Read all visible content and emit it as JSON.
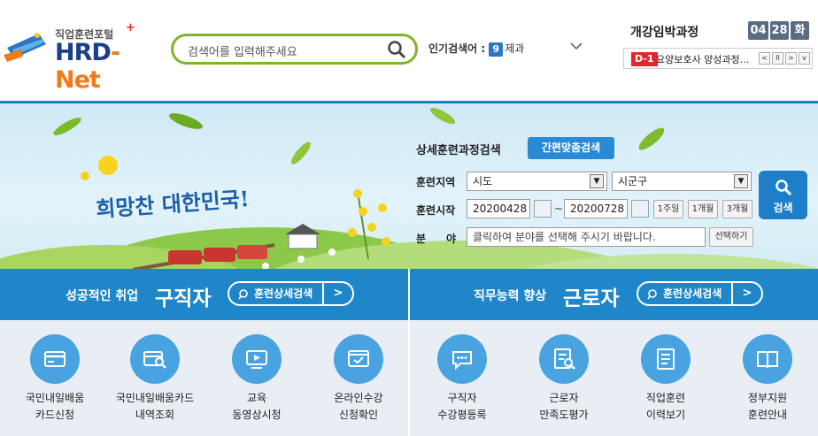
{
  "header": {
    "logo_sub": "직업훈련포털",
    "logo_main_a": "HRD",
    "logo_main_b": "-Net",
    "search_placeholder": "검색어를 입력해주세요",
    "popular_label": "인기검색어 :",
    "popular_rank": "9",
    "popular_term": "제과"
  },
  "upcoming": {
    "title": "개강임박과정",
    "month": "04",
    "day": "28",
    "weekday": "화",
    "dday": "D-1",
    "course": "요양보호사 양성과정…"
  },
  "form": {
    "title": "상세훈련과정검색",
    "quick_button": "간편맞춤검색",
    "region_label": "훈련지역",
    "region_city": "시도",
    "region_district": "시군구",
    "start_label": "훈련시작",
    "date_from": "20200428",
    "tilde": "~",
    "date_to": "20200728",
    "range_1w": "1주일",
    "range_1m": "1개월",
    "range_3m": "3개월",
    "field_label_a": "분",
    "field_label_b": "야",
    "field_placeholder": "클릭하여 분야를 선택해 주시기 바랍니다.",
    "select_button": "선택하기",
    "search_button": "검색"
  },
  "banner": {
    "slogan": "희망찬 대한민국!"
  },
  "jobseeker": {
    "lead": "성공적인 취업",
    "title": "구직자",
    "button": "훈련상세검색"
  },
  "worker": {
    "lead": "직무능력 향상",
    "title": "근로자",
    "button": "훈련상세검색"
  },
  "menu": [
    {
      "l1": "국민내일배움",
      "l2": "카드신청",
      "icon": "card-icon"
    },
    {
      "l1": "국민내일배움카드",
      "l2": "내역조회",
      "icon": "card-search-icon"
    },
    {
      "l1": "교육",
      "l2": "동영상시청",
      "icon": "video-icon"
    },
    {
      "l1": "온라인수강",
      "l2": "신청확인",
      "icon": "online-check-icon"
    },
    {
      "l1": "구직자",
      "l2": "수강평등록",
      "icon": "review-icon"
    },
    {
      "l1": "근로자",
      "l2": "만족도평가",
      "icon": "survey-icon"
    },
    {
      "l1": "직업훈련",
      "l2": "이력보기",
      "icon": "history-icon"
    },
    {
      "l1": "정부지원",
      "l2": "훈련안내",
      "icon": "guide-icon"
    }
  ],
  "colors": {
    "accent": "#1f86c9",
    "logo_orange": "#f07b1a",
    "search_border": "#7db52c",
    "dday": "#e3262f"
  }
}
